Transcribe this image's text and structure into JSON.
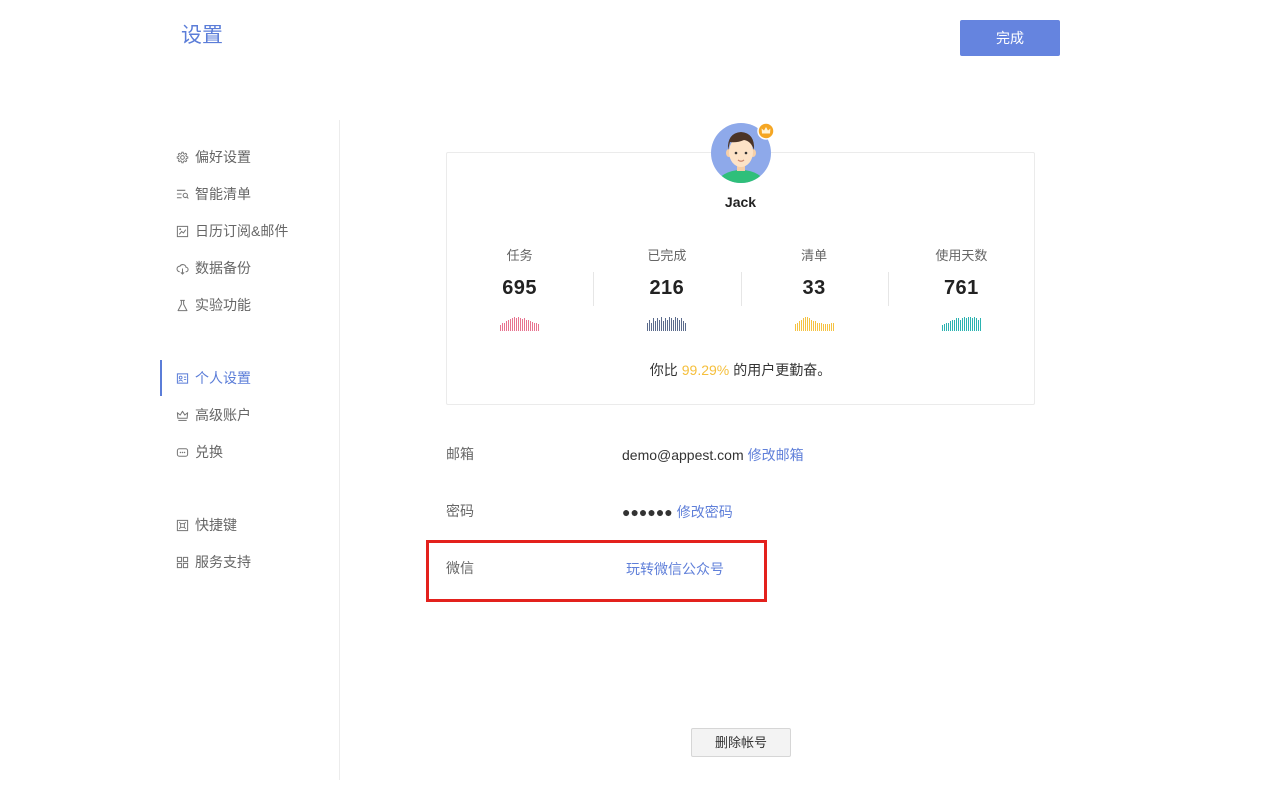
{
  "header": {
    "title": "设置",
    "done_label": "完成"
  },
  "sidebar": {
    "items": [
      {
        "label": "偏好设置",
        "icon": "gear-icon"
      },
      {
        "label": "智能清单",
        "icon": "smart-list-icon"
      },
      {
        "label": "日历订阅&邮件",
        "icon": "calendar-icon"
      },
      {
        "label": "数据备份",
        "icon": "cloud-backup-icon"
      },
      {
        "label": "实验功能",
        "icon": "flask-icon"
      },
      {
        "label": "个人设置",
        "icon": "id-card-icon",
        "active": true
      },
      {
        "label": "高级账户",
        "icon": "crown-icon"
      },
      {
        "label": "兑换",
        "icon": "coupon-icon"
      },
      {
        "label": "快捷键",
        "icon": "shortcut-icon"
      },
      {
        "label": "服务支持",
        "icon": "grid-icon"
      }
    ]
  },
  "profile": {
    "name": "Jack",
    "avatar_icon": "avatar-icon",
    "badge_icon": "crown-badge-icon",
    "stats": [
      {
        "label": "任务",
        "value": "695",
        "color": "#e8738f",
        "trend": [
          0.45,
          0.55,
          0.6,
          0.7,
          0.75,
          0.85,
          0.9,
          1,
          0.95,
          1,
          0.9,
          0.85,
          0.9,
          0.8,
          0.75,
          0.7,
          0.65,
          0.6,
          0.55,
          0.5
        ]
      },
      {
        "label": "已完成",
        "value": "216",
        "color": "#5b6b8c",
        "trend": [
          0.6,
          0.8,
          0.6,
          0.9,
          0.7,
          0.9,
          0.8,
          1,
          0.7,
          0.9,
          0.8,
          1,
          0.9,
          0.8,
          1,
          0.9,
          0.8,
          0.9,
          0.7,
          0.6
        ]
      },
      {
        "label": "清单",
        "value": "33",
        "color": "#f5c242",
        "trend": [
          0.5,
          0.6,
          0.7,
          0.8,
          0.9,
          1,
          1,
          0.9,
          0.8,
          0.7,
          0.7,
          0.6,
          0.6,
          0.6,
          0.5,
          0.5,
          0.5,
          0.5,
          0.6,
          0.6
        ]
      },
      {
        "label": "使用天数",
        "value": "761",
        "color": "#2bb3b1",
        "trend": [
          0.4,
          0.5,
          0.6,
          0.6,
          0.7,
          0.8,
          0.8,
          0.9,
          0.9,
          0.8,
          0.9,
          1,
          0.9,
          1,
          1,
          0.9,
          1,
          0.9,
          0.8,
          0.9
        ]
      }
    ],
    "comparison": {
      "prefix": "你比",
      "percent": "99.29%",
      "suffix": "的用户更勤奋。"
    }
  },
  "account": {
    "email": {
      "label": "邮箱",
      "value": "demo@appest.com",
      "action": "修改邮箱"
    },
    "password": {
      "label": "密码",
      "value": "●●●●●●",
      "action": "修改密码"
    },
    "wechat": {
      "label": "微信",
      "action": "玩转微信公众号"
    }
  },
  "delete_account_label": "删除帐号",
  "colors": {
    "accent": "#5b7dd8",
    "button": "#6584df",
    "link": "#5f7fd9",
    "highlight_percent": "#f5bf3c",
    "annotation_box": "#e3211d"
  }
}
